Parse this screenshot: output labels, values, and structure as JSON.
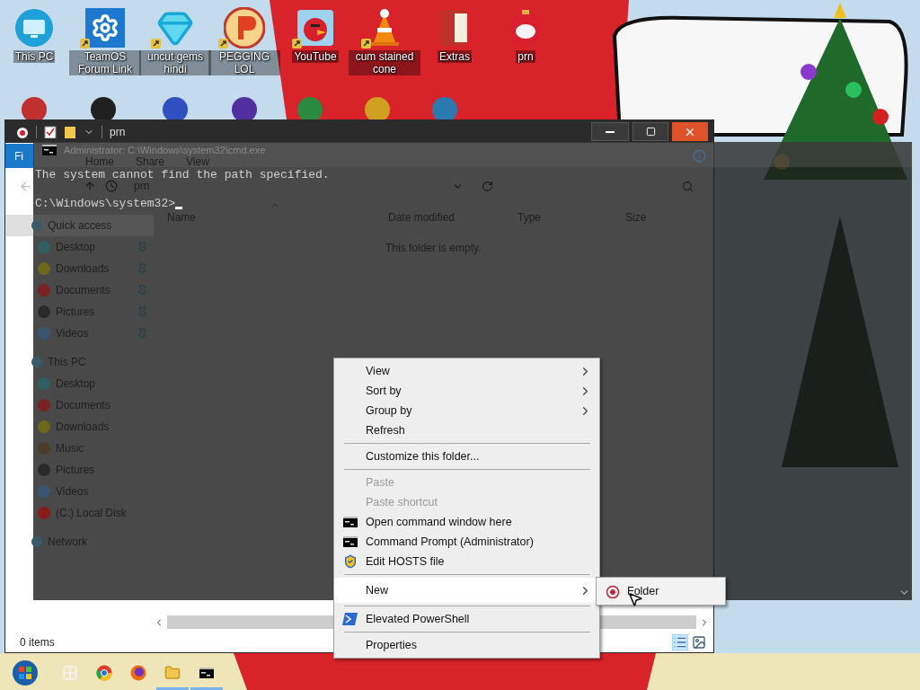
{
  "desktop": {
    "shortcuts": [
      {
        "label": "This PC",
        "kind": "monitor",
        "shortcut": false
      },
      {
        "label": "TeamOS Forum Link",
        "kind": "gear",
        "shortcut": true
      },
      {
        "label": "uncut gems hindi",
        "kind": "gem",
        "shortcut": true
      },
      {
        "label": "PEGGING LOL",
        "kind": "badge",
        "shortcut": true
      },
      {
        "label": "YouTube",
        "kind": "bird",
        "shortcut": true
      },
      {
        "label": "cum stained cone",
        "kind": "cone",
        "shortcut": true
      },
      {
        "label": "Extras",
        "kind": "book",
        "shortcut": false
      },
      {
        "label": "prn",
        "kind": "ornament",
        "shortcut": false
      }
    ]
  },
  "explorer": {
    "title": "prn",
    "ribbon_tabs": [
      {
        "label": "Fi",
        "kind": "file"
      },
      {
        "label": "Home",
        "kind": "tab"
      },
      {
        "label": "Share",
        "kind": "tab"
      },
      {
        "label": "View",
        "kind": "tab"
      }
    ],
    "address": "prn",
    "columns": [
      {
        "label": "Name",
        "sorted": true
      },
      {
        "label": "Date modified",
        "sorted": false
      },
      {
        "label": "Type",
        "sorted": false
      },
      {
        "label": "Size",
        "sorted": false
      }
    ],
    "empty_message": "This folder is empty.",
    "navigation": [
      {
        "label": "Quick access",
        "selected": true,
        "children": [
          {
            "label": "Desktop",
            "selected": false,
            "pinned": true,
            "color": "#2f5f5f"
          },
          {
            "label": "Downloads",
            "selected": false,
            "pinned": true,
            "color": "#6a6a1a"
          },
          {
            "label": "Documents",
            "selected": false,
            "pinned": true,
            "color": "#7a2222"
          },
          {
            "label": "Pictures",
            "selected": false,
            "pinned": true,
            "color": "#2a2a2a"
          },
          {
            "label": "Videos",
            "selected": false,
            "pinned": true,
            "color": "#3a5570"
          }
        ]
      },
      {
        "label": "This PC",
        "selected": false,
        "children": [
          {
            "label": "Desktop",
            "selected": false,
            "pinned": false,
            "color": "#2f5f5f"
          },
          {
            "label": "Documents",
            "selected": false,
            "pinned": false,
            "color": "#7a2222"
          },
          {
            "label": "Downloads",
            "selected": false,
            "pinned": false,
            "color": "#6a6a1a"
          },
          {
            "label": "Music",
            "selected": false,
            "pinned": false,
            "color": "#4a3c28"
          },
          {
            "label": "Pictures",
            "selected": false,
            "pinned": false,
            "color": "#2a2a2a"
          },
          {
            "label": "Videos",
            "selected": false,
            "pinned": false,
            "color": "#3a5570"
          },
          {
            "label": "(C:) Local Disk",
            "selected": false,
            "pinned": false,
            "color": "#8a1a1a"
          }
        ]
      },
      {
        "label": "Network",
        "selected": false
      }
    ],
    "status": "0 items"
  },
  "console": {
    "title": "Administrator: C:\\Windows\\system32\\cmd.exe",
    "output": "The system cannot find the path specified.",
    "prompt": "C:\\Windows\\system32>"
  },
  "context_menu": {
    "groups": [
      [
        {
          "label": "View",
          "kind": "text",
          "disabled": false,
          "submenu": true,
          "selected": false
        },
        {
          "label": "Sort by",
          "kind": "text",
          "disabled": false,
          "submenu": true,
          "selected": false
        },
        {
          "label": "Group by",
          "kind": "text",
          "disabled": false,
          "submenu": true,
          "selected": false
        },
        {
          "label": "Refresh",
          "kind": "text",
          "disabled": false,
          "submenu": false,
          "selected": false
        }
      ],
      [
        {
          "label": "Customize this folder...",
          "kind": "text",
          "disabled": false,
          "submenu": false,
          "selected": false
        }
      ],
      [
        {
          "label": "Paste",
          "kind": "text",
          "disabled": true,
          "submenu": false,
          "selected": false
        },
        {
          "label": "Paste shortcut",
          "kind": "text",
          "disabled": true,
          "submenu": false,
          "selected": false
        },
        {
          "label": "Open command window here",
          "kind": "console",
          "disabled": false,
          "submenu": false,
          "selected": false
        },
        {
          "label": "Command Prompt (Administrator)",
          "kind": "console",
          "disabled": false,
          "submenu": false,
          "selected": false
        },
        {
          "label": "Edit HOSTS file",
          "kind": "shield",
          "disabled": false,
          "submenu": false,
          "selected": false
        }
      ],
      [
        {
          "label": "New",
          "kind": "text",
          "disabled": false,
          "submenu": true,
          "selected": true
        }
      ],
      [
        {
          "label": "Elevated PowerShell",
          "kind": "shell",
          "disabled": false,
          "submenu": false,
          "selected": false
        }
      ],
      [
        {
          "label": "Properties",
          "kind": "text",
          "disabled": false,
          "submenu": false,
          "selected": false
        }
      ]
    ]
  },
  "submenu": {
    "items": [
      {
        "label": "Folder"
      }
    ]
  },
  "taskbar": {
    "items": [
      {
        "kind": "start",
        "active": false
      },
      {
        "kind": "app",
        "active": false
      },
      {
        "kind": "browser",
        "active": false
      },
      {
        "kind": "fox",
        "active": false
      },
      {
        "kind": "folder",
        "active": true
      },
      {
        "kind": "console",
        "active": true
      }
    ]
  }
}
